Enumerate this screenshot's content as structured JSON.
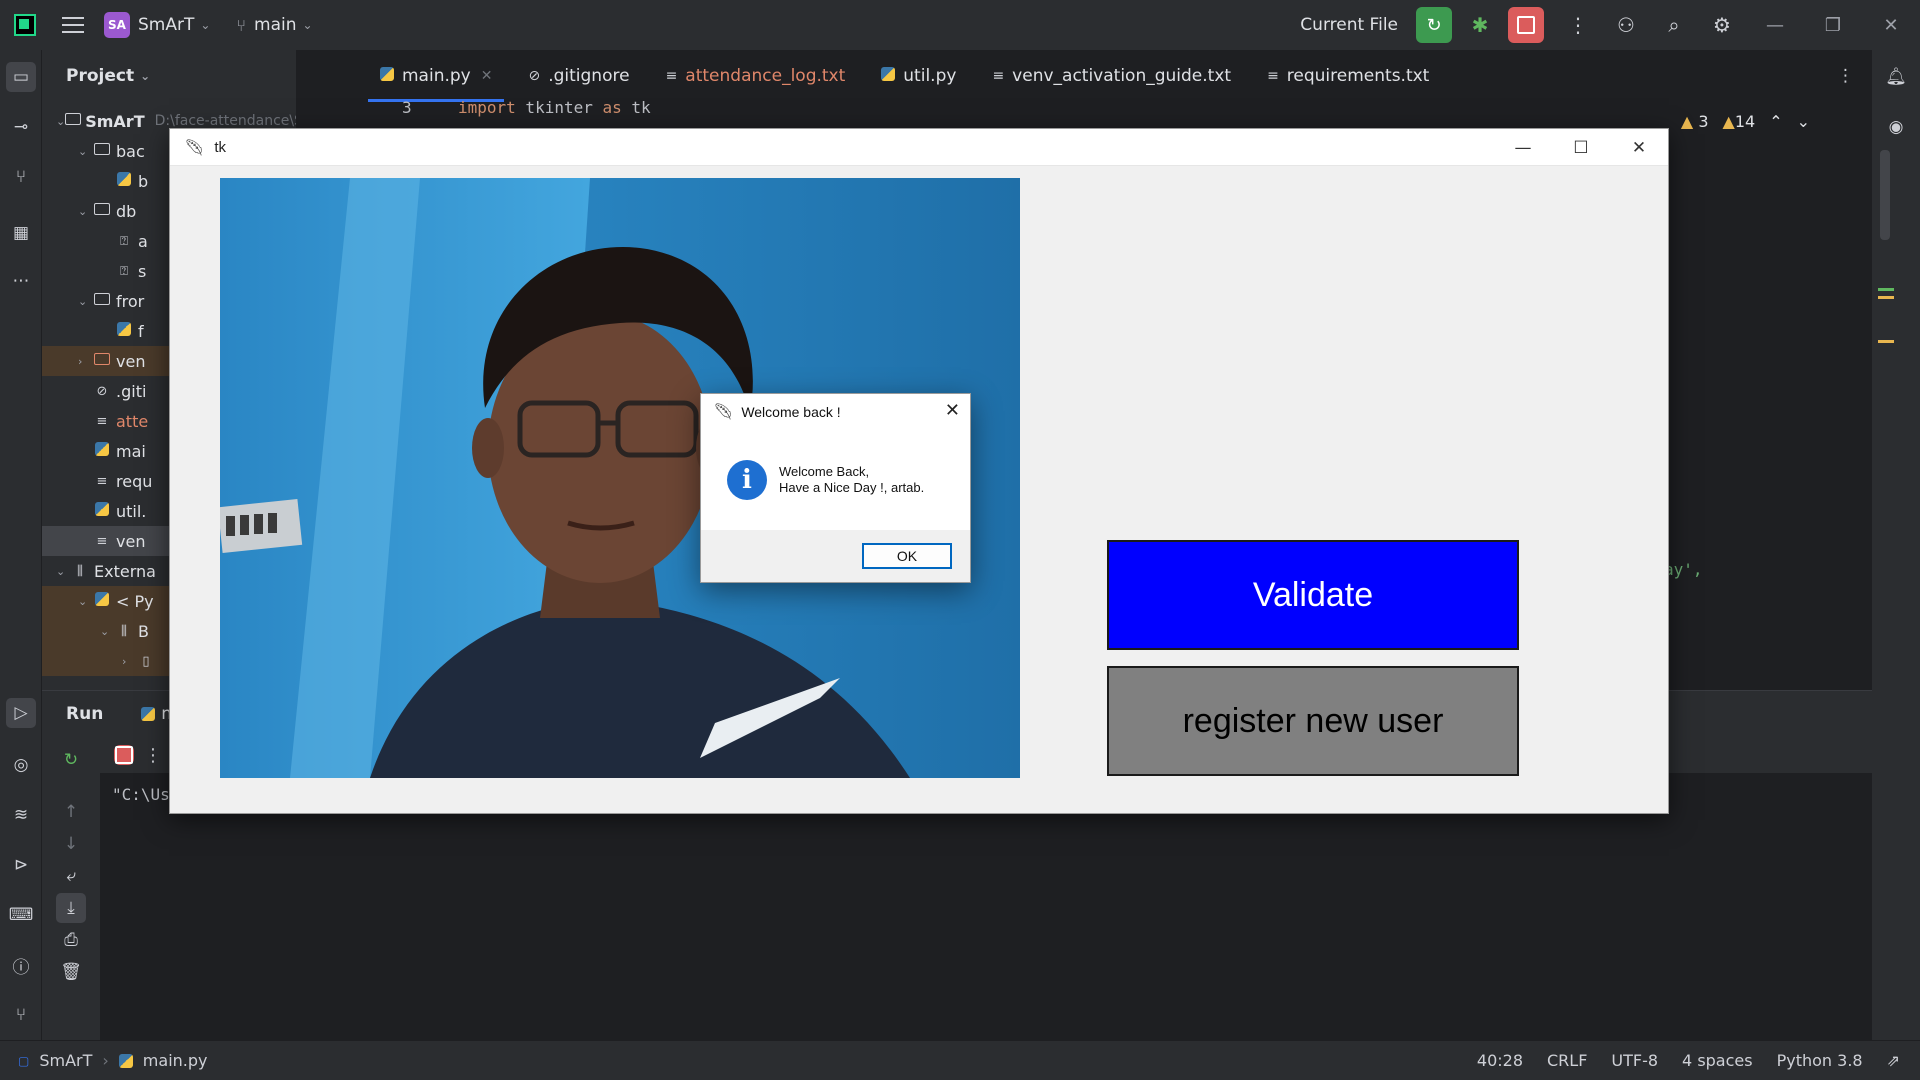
{
  "toolbar": {
    "project_initials": "SA",
    "project_name": "SmArT",
    "branch": "main",
    "run_config": "Current File"
  },
  "project_panel": {
    "title": "Project",
    "root_name": "SmArT",
    "root_path": "D:\\face-attendance\\Sm",
    "rows": [
      "bac",
      "b",
      "db",
      "a",
      "s",
      "fror",
      "f",
      "ven",
      ".giti",
      "atte",
      "mai",
      "requ",
      "util.",
      "ven",
      "Externa",
      "< Py",
      "B",
      ""
    ]
  },
  "tabs": [
    {
      "label": "main.py"
    },
    {
      "label": ".gitignore"
    },
    {
      "label": "attendance_log.txt"
    },
    {
      "label": "util.py"
    },
    {
      "label": "venv_activation_guide.txt"
    },
    {
      "label": "requirements.txt"
    }
  ],
  "editor": {
    "line_number": "3",
    "line_text_kw": "import",
    "line_text": " tkinter ",
    "line_text_as": "as",
    "line_text_tail": " tk",
    "warnings_a": "3",
    "warnings_b": "14",
    "fragment": "ay',"
  },
  "run_panel": {
    "title": "Run",
    "tab_fragment": "m",
    "console_line": "\"C:\\Us"
  },
  "statusbar": {
    "project": "SmArT",
    "file": "main.py",
    "position": "40:28",
    "line_ending": "CRLF",
    "encoding": "UTF-8",
    "indent": "4 spaces",
    "interpreter": "Python 3.8"
  },
  "tk_window": {
    "title": "tk",
    "validate_label": "Validate",
    "register_label": "register new user"
  },
  "messagebox": {
    "title": "Welcome back !",
    "line1": "Welcome Back,",
    "line2": "Have a Nice Day !, artab.",
    "ok_label": "OK"
  },
  "colors": {
    "validate_bg": "#0000ff",
    "register_bg": "#808080",
    "ide_bg": "#1e1f22",
    "accent": "#3574f0"
  }
}
